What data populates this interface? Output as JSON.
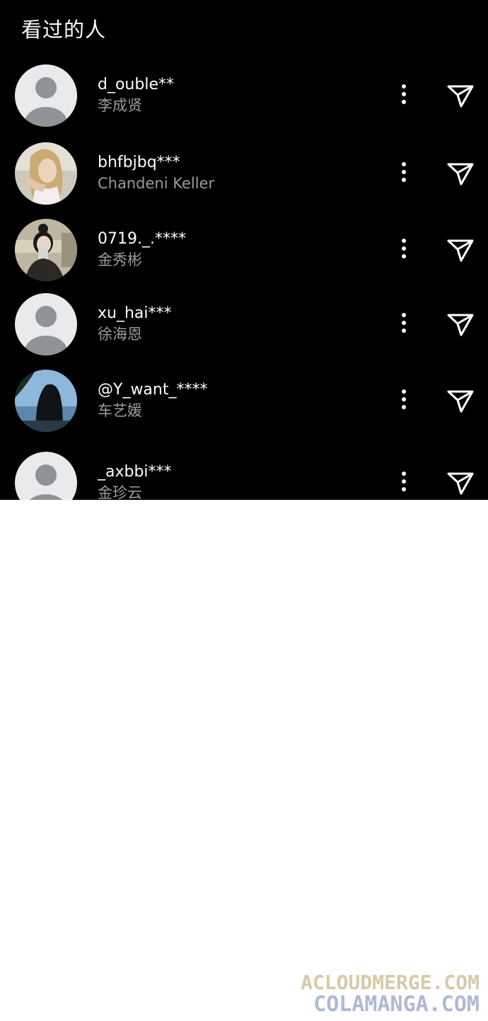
{
  "panel": {
    "title": "看过的人"
  },
  "viewers": [
    {
      "username": "d_ouble**",
      "display_name": "李成贤",
      "avatar": "default-avatar"
    },
    {
      "username": "bhfbjbq***",
      "display_name": "Chandeni Keller",
      "avatar": "blonde-woman-photo"
    },
    {
      "username": "0719._.****",
      "display_name": "金秀彬",
      "avatar": "mirror-selfie-photo"
    },
    {
      "username": "xu_hai***",
      "display_name": "徐海恩",
      "avatar": "default-avatar"
    },
    {
      "username": "@Y_want_****",
      "display_name": "车艺媛",
      "avatar": "beach-silhouette-photo"
    },
    {
      "username": "_axbbi***",
      "display_name": "金珍云",
      "avatar": "default-avatar"
    }
  ],
  "icons": {
    "more": "more-vertical-icon",
    "send": "paper-plane-icon"
  },
  "colors": {
    "background": "#000000",
    "username": "#ffffff",
    "display_name": "#9a9a9a",
    "default_avatar_bg": "#e9eaec",
    "default_avatar_figure": "#8f9297"
  },
  "watermark": {
    "line1": "ACLOUDMERGE.COM",
    "line2": "COLAMANGA.COM"
  }
}
